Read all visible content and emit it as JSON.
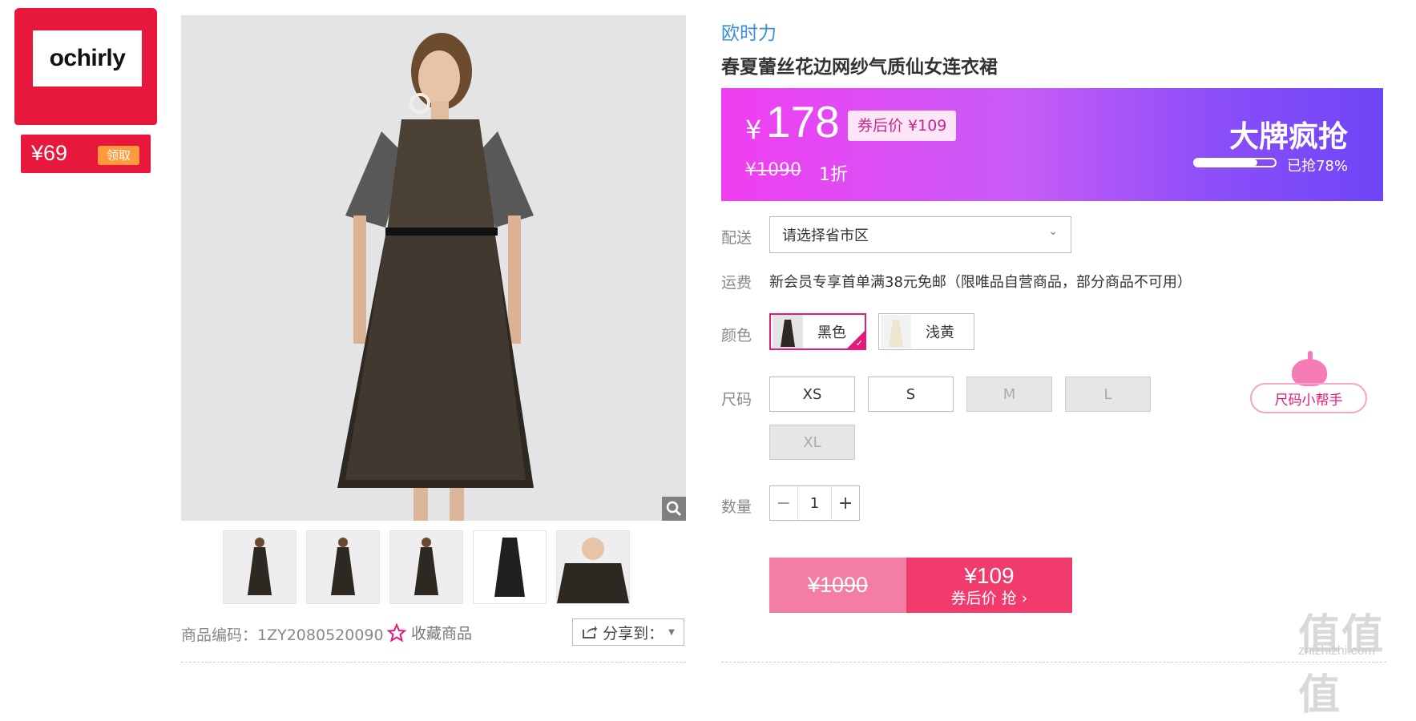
{
  "coupon": {
    "logo": "ochirly",
    "price": "¥69",
    "action": "领取"
  },
  "gallery": {
    "thumbnails": [
      "thumb-1",
      "thumb-2",
      "thumb-3",
      "thumb-4",
      "thumb-5"
    ]
  },
  "meta": {
    "code": "商品编码：1ZY2080520090",
    "favorite": "收藏商品",
    "share": "分享到："
  },
  "product": {
    "brand": "欧时力",
    "title": "春夏蕾丝花边网纱气质仙女连衣裙"
  },
  "promo": {
    "yen": "¥",
    "price": "178",
    "coupon_price": "券后价 ¥109",
    "original": "¥1090",
    "discount": "1折",
    "banner": "大牌疯抢",
    "sold_text": "已抢78%",
    "sold_fraction": 0.78
  },
  "delivery": {
    "label": "配送",
    "placeholder": "请选择省市区"
  },
  "freight": {
    "label": "运费",
    "text": "新会员专享首单满38元免邮（限唯品自营商品，部分商品不可用）"
  },
  "colors": {
    "label": "颜色",
    "options": [
      "黑色",
      "浅黄"
    ]
  },
  "sizes": {
    "label": "尺码",
    "options": [
      "XS",
      "S",
      "M",
      "L",
      "XL"
    ],
    "helper": "尺码小帮手"
  },
  "quantity": {
    "label": "数量",
    "value": "1",
    "minus": "−",
    "plus": "+"
  },
  "buy": {
    "original": "¥1090",
    "price": "¥109",
    "action": "券后价 抢 ›"
  },
  "watermark": {
    "main": "值值值",
    "sub": "zhizhizhi.com"
  }
}
